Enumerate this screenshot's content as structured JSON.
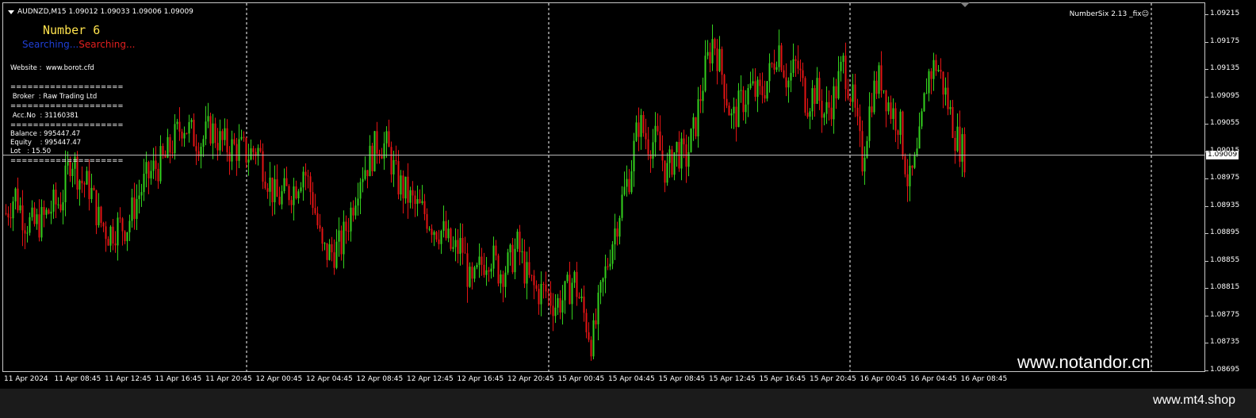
{
  "header": {
    "symbol_info": "AUDNZD,M15  1.09012 1.09033 1.09006 1.09009"
  },
  "indicator_label": "NumberSix 2.13 _fix☺",
  "ea": {
    "name": "Number 6",
    "status_1": "Searching...",
    "status_2": "Searching..."
  },
  "info_panel": {
    "website": "Website :  www.borot.cfd",
    "separator": "====================",
    "broker": " Broker  : Raw Trading Ltd",
    "account": " Acc.No  : 31160381",
    "balance": "Balance : 995447.47",
    "equity": "Equity    : 995447.47",
    "lot": "Lot   : 15.50"
  },
  "price_axis": {
    "ticks": [
      "1.09215",
      "1.09175",
      "1.09135",
      "1.09095",
      "1.09055",
      "1.09015",
      "1.08975",
      "1.08935",
      "1.08895",
      "1.08855",
      "1.08815",
      "1.08775",
      "1.08735",
      "1.08695"
    ],
    "current_price": "1.09009"
  },
  "time_axis": {
    "ticks": [
      "11 Apr 2024",
      "11 Apr 08:45",
      "11 Apr 12:45",
      "11 Apr 16:45",
      "11 Apr 20:45",
      "12 Apr 00:45",
      "12 Apr 04:45",
      "12 Apr 08:45",
      "12 Apr 12:45",
      "12 Apr 16:45",
      "12 Apr 20:45",
      "15 Apr 00:45",
      "15 Apr 04:45",
      "15 Apr 08:45",
      "15 Apr 12:45",
      "15 Apr 16:45",
      "15 Apr 20:45",
      "16 Apr 00:45",
      "16 Apr 04:45",
      "16 Apr 08:45"
    ]
  },
  "watermark": "www.notandor.cn",
  "footer_url": "www.mt4.shop",
  "colors": {
    "bull": "#34d11e",
    "bear": "#e41414",
    "background": "#000000",
    "grid": "#ffffff"
  },
  "chart_data": {
    "type": "candlestick",
    "symbol": "AUDNZD",
    "timeframe": "M15",
    "ylim": [
      1.0868,
      1.0923
    ],
    "price_line": 1.09009,
    "close_path": [
      [
        0,
        1.0892
      ],
      [
        3,
        1.0895
      ],
      [
        6,
        1.0891
      ],
      [
        9,
        1.089
      ],
      [
        12,
        1.0891
      ],
      [
        15,
        1.0893
      ],
      [
        18,
        1.0894
      ],
      [
        21,
        1.0901
      ],
      [
        24,
        1.0897
      ],
      [
        27,
        1.0896
      ],
      [
        30,
        1.0891
      ],
      [
        33,
        1.0889
      ],
      [
        36,
        1.089
      ],
      [
        39,
        1.089
      ],
      [
        42,
        1.0894
      ],
      [
        45,
        1.0897
      ],
      [
        48,
        1.0899
      ],
      [
        51,
        1.09
      ],
      [
        54,
        1.0903
      ],
      [
        57,
        1.0906
      ],
      [
        60,
        1.0904
      ],
      [
        63,
        1.0903
      ],
      [
        66,
        1.0905
      ],
      [
        69,
        1.0903
      ],
      [
        72,
        1.0902
      ],
      [
        75,
        1.0902
      ],
      [
        78,
        1.0901
      ],
      [
        81,
        1.0902
      ],
      [
        84,
        1.0898
      ],
      [
        87,
        1.0894
      ],
      [
        90,
        1.0895
      ],
      [
        93,
        1.0896
      ],
      [
        96,
        1.0899
      ],
      [
        99,
        1.0894
      ],
      [
        102,
        1.0886
      ],
      [
        105,
        1.0886
      ],
      [
        108,
        1.0887
      ],
      [
        111,
        1.0892
      ],
      [
        114,
        1.0898
      ],
      [
        117,
        1.09
      ],
      [
        120,
        1.0903
      ],
      [
        123,
        1.0902
      ],
      [
        126,
        1.0897
      ],
      [
        129,
        1.0895
      ],
      [
        132,
        1.0893
      ],
      [
        135,
        1.0892
      ],
      [
        138,
        1.089
      ],
      [
        141,
        1.0889
      ],
      [
        144,
        1.0886
      ],
      [
        147,
        1.0887
      ],
      [
        150,
        1.088
      ],
      [
        153,
        1.0884
      ],
      [
        156,
        1.0886
      ],
      [
        159,
        1.0883
      ],
      [
        162,
        1.0884
      ],
      [
        165,
        1.0887
      ],
      [
        168,
        1.0882
      ],
      [
        171,
        1.088
      ],
      [
        174,
        1.088
      ],
      [
        177,
        1.0878
      ],
      [
        180,
        1.0879
      ],
      [
        183,
        1.0882
      ],
      [
        186,
        1.0877
      ],
      [
        189,
        1.0872
      ],
      [
        192,
        1.088
      ],
      [
        195,
        1.0887
      ],
      [
        198,
        1.0893
      ],
      [
        201,
        1.0898
      ],
      [
        204,
        1.0906
      ],
      [
        207,
        1.0903
      ],
      [
        210,
        1.0903
      ],
      [
        213,
        1.0898
      ],
      [
        216,
        1.0902
      ],
      [
        219,
        1.09
      ],
      [
        222,
        1.0905
      ],
      [
        225,
        1.0913
      ],
      [
        228,
        1.0919
      ],
      [
        231,
        1.0913
      ],
      [
        234,
        1.0906
      ],
      [
        237,
        1.0909
      ],
      [
        240,
        1.0911
      ],
      [
        243,
        1.091
      ],
      [
        246,
        1.0913
      ],
      [
        249,
        1.0918
      ],
      [
        252,
        1.0912
      ],
      [
        255,
        1.0915
      ],
      [
        258,
        1.0909
      ],
      [
        261,
        1.0911
      ],
      [
        264,
        1.0907
      ],
      [
        267,
        1.091
      ],
      [
        270,
        1.0915
      ],
      [
        273,
        1.0909
      ],
      [
        276,
        1.09
      ],
      [
        279,
        1.091
      ],
      [
        282,
        1.0913
      ],
      [
        285,
        1.0908
      ],
      [
        288,
        1.0906
      ],
      [
        291,
        1.0896
      ],
      [
        294,
        1.0901
      ],
      [
        297,
        1.0913
      ],
      [
        300,
        1.0915
      ],
      [
        303,
        1.091
      ],
      [
        306,
        1.0904
      ],
      [
        309,
        1.0901
      ]
    ]
  }
}
